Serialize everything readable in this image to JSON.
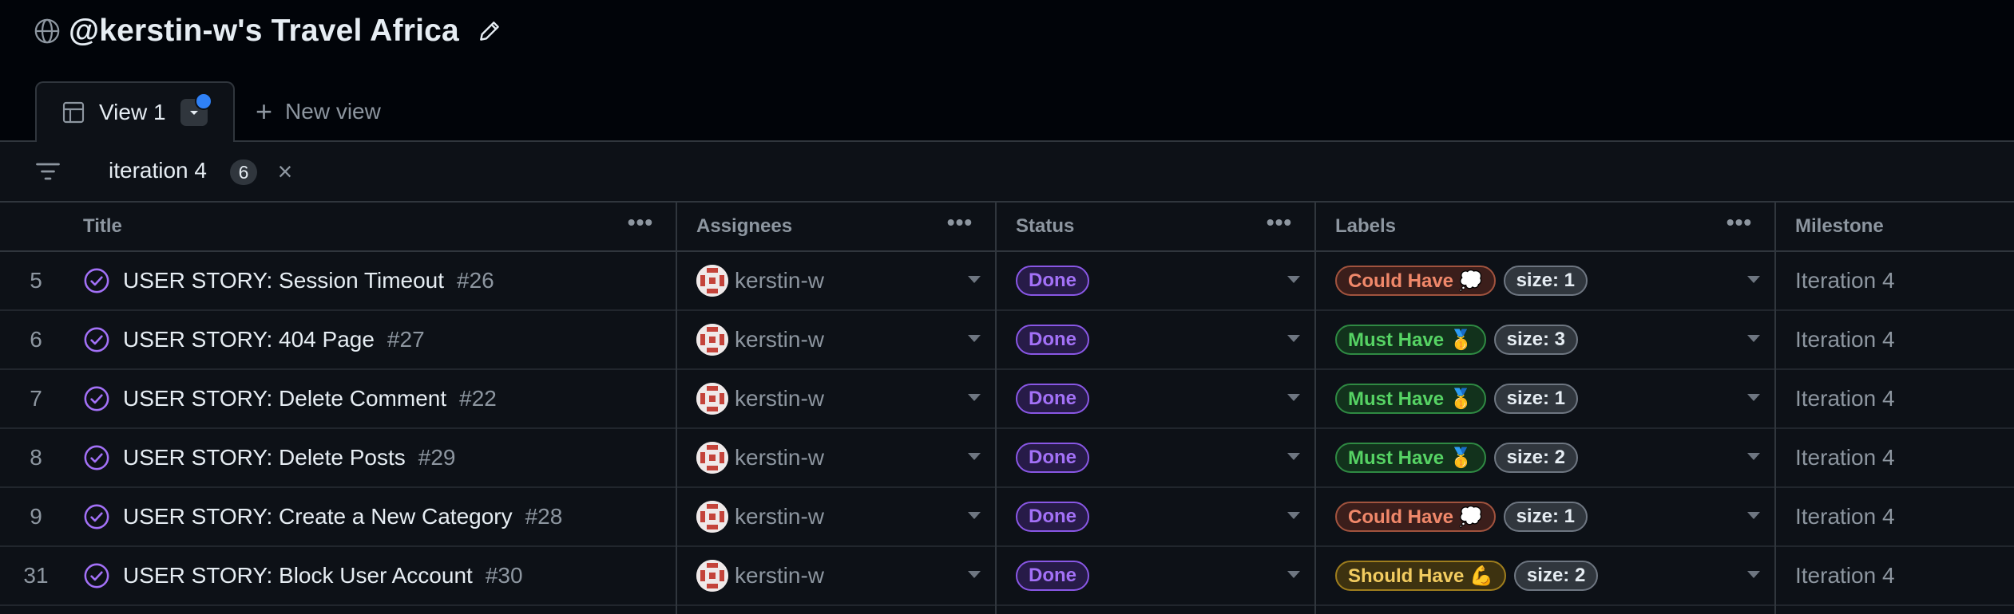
{
  "project": {
    "title": "@kerstin-w's Travel Africa"
  },
  "tabs": {
    "active_label": "View 1",
    "new_view_label": "New view"
  },
  "filter": {
    "text": "iteration 4",
    "count": "6",
    "clear": "×"
  },
  "columns": {
    "title": "Title",
    "assignees": "Assignees",
    "status": "Status",
    "labels": "Labels",
    "milestone": "Milestone",
    "menu_glyph": "•••"
  },
  "label_colors": {
    "Could Have 💭": {
      "bg": "#3b1e1b",
      "border": "#a1533e",
      "fg": "#f0886a"
    },
    "Must Have 🥇": {
      "bg": "#12321c",
      "border": "#2f8a43",
      "fg": "#56d364"
    },
    "Should Have 💪": {
      "bg": "#3d3210",
      "border": "#9e7d1d",
      "fg": "#f2cc60"
    }
  },
  "rows": [
    {
      "num": "5",
      "title": "USER STORY: Session Timeout",
      "issue": "#26",
      "assignee": "kerstin-w",
      "status": "Done",
      "label": "Could Have 💭",
      "size": "size: 1",
      "milestone": "Iteration 4"
    },
    {
      "num": "6",
      "title": "USER STORY: 404 Page",
      "issue": "#27",
      "assignee": "kerstin-w",
      "status": "Done",
      "label": "Must Have 🥇",
      "size": "size: 3",
      "milestone": "Iteration 4"
    },
    {
      "num": "7",
      "title": "USER STORY: Delete Comment",
      "issue": "#22",
      "assignee": "kerstin-w",
      "status": "Done",
      "label": "Must Have 🥇",
      "size": "size: 1",
      "milestone": "Iteration 4"
    },
    {
      "num": "8",
      "title": "USER STORY: Delete Posts",
      "issue": "#29",
      "assignee": "kerstin-w",
      "status": "Done",
      "label": "Must Have 🥇",
      "size": "size: 2",
      "milestone": "Iteration 4"
    },
    {
      "num": "9",
      "title": "USER STORY: Create a New Category",
      "issue": "#28",
      "assignee": "kerstin-w",
      "status": "Done",
      "label": "Could Have 💭",
      "size": "size: 1",
      "milestone": "Iteration 4"
    },
    {
      "num": "31",
      "title": "USER STORY: Block User Account",
      "issue": "#30",
      "assignee": "kerstin-w",
      "status": "Done",
      "label": "Should Have 💪",
      "size": "size: 2",
      "milestone": "Iteration 4"
    }
  ]
}
